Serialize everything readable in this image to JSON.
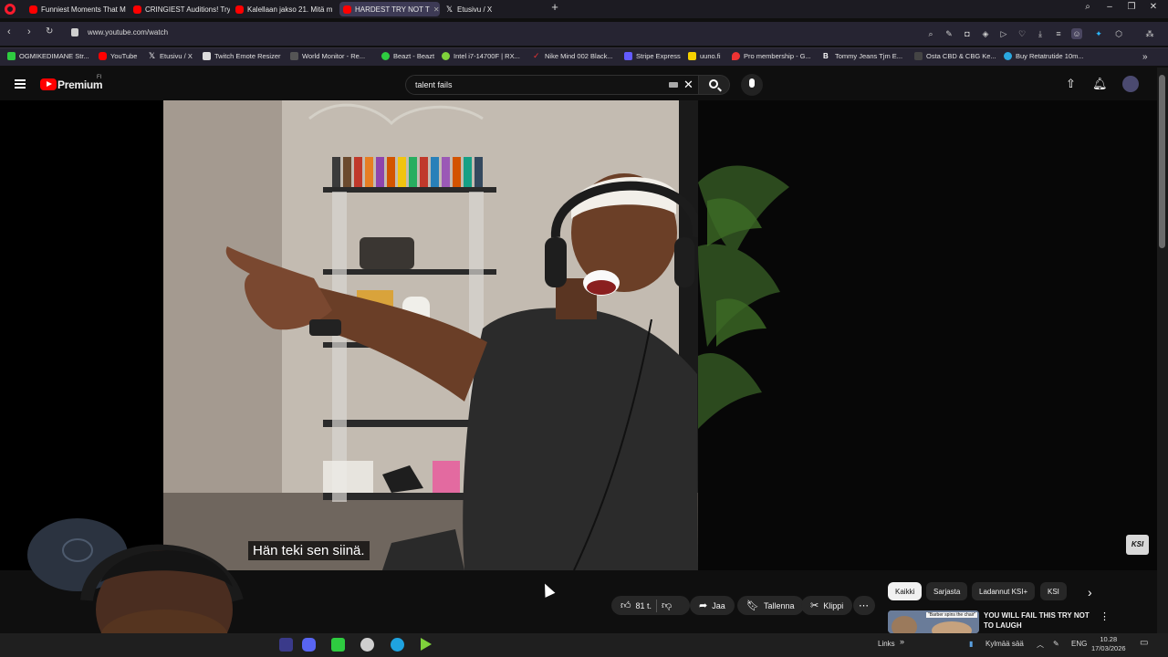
{
  "browser": {
    "tabs": [
      {
        "label": "Funniest Moments That M",
        "favicon": "youtube-icon"
      },
      {
        "label": "CRINGIEST Auditions! Try",
        "favicon": "youtube-icon"
      },
      {
        "label": "Kalellaan jakso 21. Mitä m",
        "favicon": "youtube-icon"
      },
      {
        "label": "HARDEST TRY NOT T",
        "favicon": "youtube-icon",
        "active": true
      },
      {
        "label": "Etusivu / X",
        "favicon": "x-icon"
      }
    ],
    "url": "www.youtube.com/watch",
    "bookmarks": [
      {
        "label": "OGMIKEDIMANE Str..."
      },
      {
        "label": "YouTube"
      },
      {
        "label": "Etusivu / X"
      },
      {
        "label": "Twitch Emote Resizer"
      },
      {
        "label": "World Monitor - Re..."
      },
      {
        "label": "Beazt - Beazt"
      },
      {
        "label": "Intel i7-14700F | RX..."
      },
      {
        "label": "Nike Mind 002 Black..."
      },
      {
        "label": "Stripe Express"
      },
      {
        "label": "uuno.fi"
      },
      {
        "label": "Pro membership - G..."
      },
      {
        "label": "Tommy Jeans Tjm E..."
      },
      {
        "label": "Osta CBD & CBG Ke..."
      },
      {
        "label": "Buy Retatrutide 10m..."
      }
    ]
  },
  "youtube": {
    "brand": "Premium",
    "region": "FI",
    "search_query": "talent fails",
    "caption": "Hän teki sen siinä.",
    "channel_watermark": "KSI",
    "actions": {
      "like_count": "81 t.",
      "share": "Jaa",
      "save": "Tallenna",
      "clip": "Klippi"
    },
    "chips": [
      "Kaikki",
      "Sarjasta",
      "Ladannut KSI+",
      "KSI"
    ],
    "recommendation": {
      "title": "YOU WILL FAIL THIS TRY NOT TO LAUGH",
      "thumb_text": "\"Barber spins the chair\""
    }
  },
  "taskbar": {
    "links_label": "Links",
    "weather": "Kylmää sää",
    "language": "ENG",
    "time": "10.28",
    "date": "17/03/2026"
  }
}
